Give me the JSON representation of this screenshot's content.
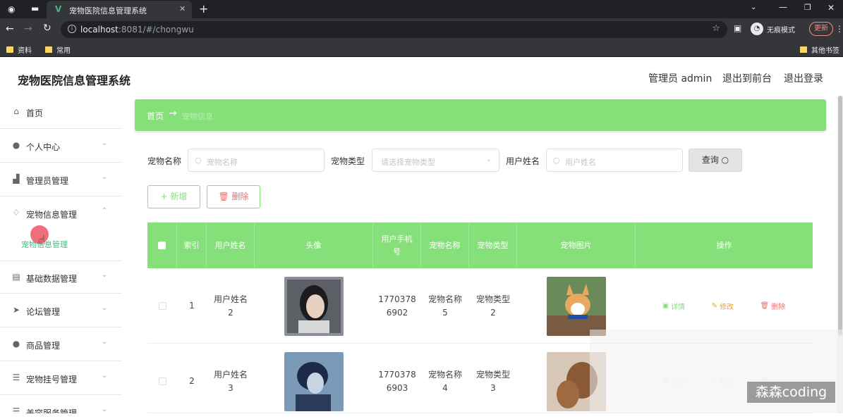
{
  "browser": {
    "tab_title": "宠物医院信息管理系统",
    "tab_icon": "V",
    "url_host": "localhost",
    "url_rest": ":8081/#/chongwu",
    "incognito_label": "无痕模式",
    "update_label": "更新",
    "bookmarks": [
      "资料",
      "常用"
    ],
    "other_bookmarks": "其他书签"
  },
  "header": {
    "title": "宠物医院信息管理系统",
    "user": "管理员 admin",
    "exit_front": "退出到前台",
    "logout": "退出登录"
  },
  "sidebar": {
    "items": [
      {
        "label": "首页",
        "icon": "home-icon"
      },
      {
        "label": "个人中心",
        "icon": "user-icon"
      },
      {
        "label": "管理员管理",
        "icon": "admin-icon"
      },
      {
        "label": "宠物信息管理",
        "icon": "bell-icon"
      },
      {
        "label": "基础数据管理",
        "icon": "chart-icon"
      },
      {
        "label": "论坛管理",
        "icon": "send-icon"
      },
      {
        "label": "商品管理",
        "icon": "user-icon"
      },
      {
        "label": "宠物挂号管理",
        "icon": "list-icon"
      },
      {
        "label": "美容服务管理",
        "icon": "list-icon"
      }
    ],
    "submenu_label": "宠物信息管理"
  },
  "breadcrumb": {
    "home": "首页",
    "arrow": "→",
    "current": "宠物信息"
  },
  "filters": {
    "pet_name_label": "宠物名称",
    "pet_name_placeholder": "宠物名称",
    "pet_type_label": "宠物类型",
    "pet_type_placeholder": "请选择宠物类型",
    "user_name_label": "用户姓名",
    "user_name_placeholder": "用户姓名",
    "query_label": "查询"
  },
  "actions": {
    "add_label": "新增",
    "delete_label": "删除"
  },
  "table": {
    "headers": [
      "索引",
      "用户姓名",
      "头像",
      "用户手机号",
      "宠物名称",
      "宠物类型",
      "宠物图片",
      "操作"
    ],
    "rows": [
      {
        "index": "1",
        "user_name_a": "用户姓名",
        "user_name_b": "2",
        "phone_a": "1770378",
        "phone_b": "6902",
        "pet_name_a": "宠物名称",
        "pet_name_b": "5",
        "pet_type_a": "宠物类型",
        "pet_type_b": "2"
      },
      {
        "index": "2",
        "user_name_a": "用户姓名",
        "user_name_b": "3",
        "phone_a": "1770378",
        "phone_b": "6903",
        "pet_name_a": "宠物名称",
        "pet_name_b": "4",
        "pet_type_a": "宠物类型",
        "pet_type_b": "3"
      }
    ],
    "op_detail": "详情",
    "op_edit": "修改",
    "op_delete": "删除"
  },
  "watermark": "森森coding",
  "colors": {
    "accent": "#86e07a",
    "danger": "#f56c6c",
    "edit": "#e6a23c"
  }
}
